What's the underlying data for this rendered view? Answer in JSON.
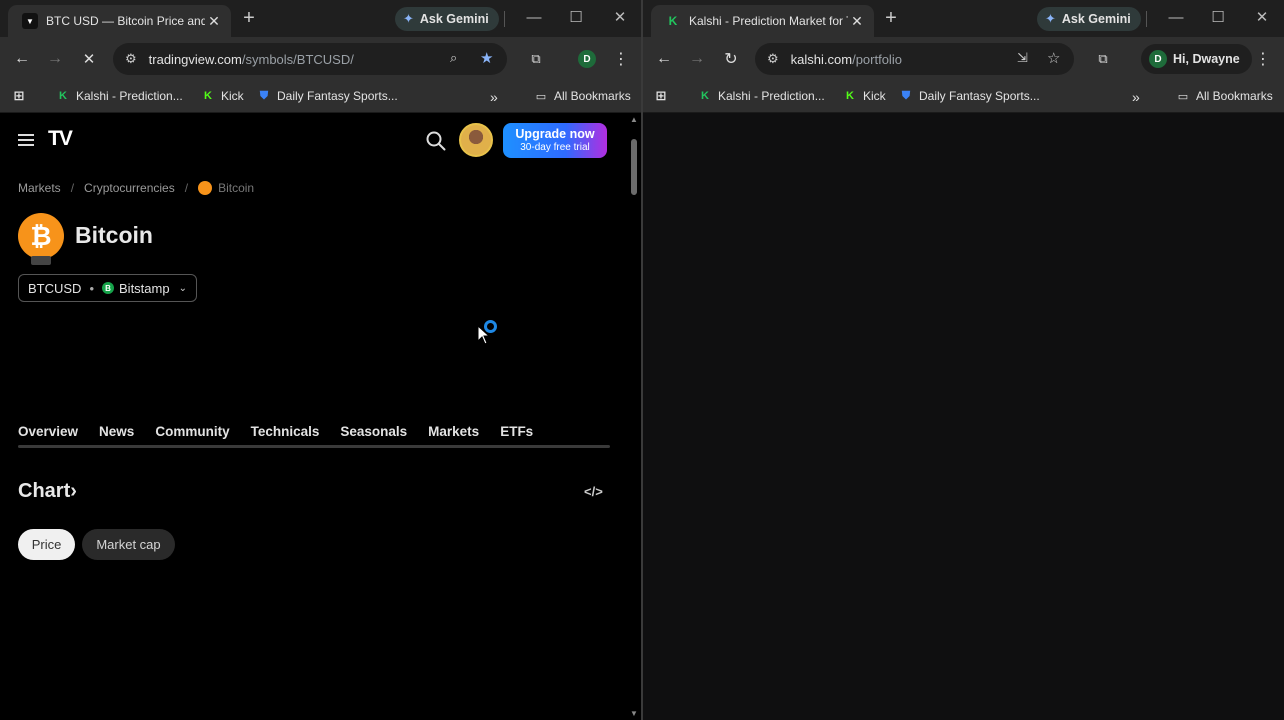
{
  "left_window": {
    "tab": {
      "title": "BTC USD — Bitcoin Price and C",
      "favicon": "TV"
    },
    "ask_gemini": "Ask Gemini",
    "address": {
      "host": "tradingview.com",
      "path": "/symbols/BTCUSD/",
      "profile_initial": "D"
    },
    "bookmarks": [
      {
        "label": "Kalshi - Prediction...",
        "icon": "K",
        "color": "#22c55e"
      },
      {
        "label": "Kick",
        "icon": "K",
        "color": "#53fc18"
      },
      {
        "label": "Daily Fantasy Sports...",
        "icon": "shield-icon",
        "color": "#3b82f6"
      }
    ],
    "all_bookmarks": "All Bookmarks"
  },
  "right_window": {
    "tab": {
      "title": "Kalshi - Prediction Market for T",
      "favicon": "K"
    },
    "ask_gemini": "Ask Gemini",
    "address": {
      "host": "kalshi.com",
      "path": "/portfolio"
    },
    "profile": {
      "initial": "D",
      "label": "Hi, Dwayne"
    },
    "bookmarks": [
      {
        "label": "Kalshi - Prediction...",
        "icon": "K"
      },
      {
        "label": "Kick",
        "icon": "K"
      },
      {
        "label": "Daily Fantasy Sports...",
        "icon": "shield-icon"
      }
    ],
    "all_bookmarks": "All Bookmarks"
  },
  "tradingview": {
    "header": {
      "upgrade_title": "Upgrade now",
      "upgrade_sub": "30-day free trial"
    },
    "breadcrumb": [
      "Markets",
      "Cryptocurrencies",
      "Bitcoin"
    ],
    "coin_name": "Bitcoin",
    "coin_symbol": "₿",
    "pair": {
      "symbol": "BTCUSD",
      "exchange": "Bitstamp"
    },
    "tabs": [
      "Overview",
      "News",
      "Community",
      "Technicals",
      "Seasonals",
      "Markets",
      "ETFs"
    ],
    "chart_title": "Chart›",
    "embed_label": "</>",
    "chart_toggles": {
      "active": "Price",
      "inactive": "Market cap"
    }
  }
}
